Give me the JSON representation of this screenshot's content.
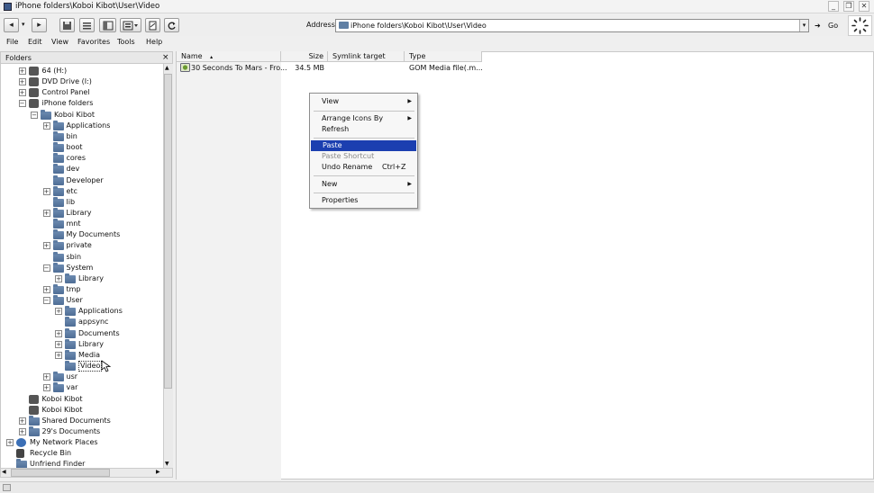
{
  "window": {
    "title": "iPhone folders\\Koboi Kibot\\User\\Video",
    "controls": [
      "_",
      "❐",
      "✕"
    ]
  },
  "toolbar": {
    "back": "◂",
    "back_drop": "▾",
    "forward": "▸",
    "address_label": "Address",
    "address_value": "iPhone folders\\Koboi Kibot\\User\\Video",
    "go_label": "Go"
  },
  "menubar": [
    "File",
    "Edit",
    "View",
    "Favorites",
    "Tools",
    "Help"
  ],
  "folders_pane": {
    "title": "Folders",
    "close": "×",
    "tree": [
      {
        "label": "64 (H:)",
        "level": 1,
        "expander": "+",
        "icon": "drive-icon"
      },
      {
        "label": "DVD Drive (I:)",
        "level": 1,
        "expander": "+",
        "icon": "dvd-drive-icon"
      },
      {
        "label": "Control Panel",
        "level": 1,
        "expander": "+",
        "icon": "control-panel-icon"
      },
      {
        "label": "iPhone folders",
        "level": 1,
        "expander": "−",
        "icon": "iphone-icon"
      },
      {
        "label": "Koboi Kibot",
        "level": 2,
        "expander": "−",
        "icon": "folder-icon"
      },
      {
        "label": "Applications",
        "level": 3,
        "expander": "+",
        "icon": "folder-icon"
      },
      {
        "label": "bin",
        "level": 3,
        "expander": "",
        "icon": "folder-icon"
      },
      {
        "label": "boot",
        "level": 3,
        "expander": "",
        "icon": "folder-icon"
      },
      {
        "label": "cores",
        "level": 3,
        "expander": "",
        "icon": "folder-icon"
      },
      {
        "label": "dev",
        "level": 3,
        "expander": "",
        "icon": "folder-icon"
      },
      {
        "label": "Developer",
        "level": 3,
        "expander": "",
        "icon": "folder-icon"
      },
      {
        "label": "etc",
        "level": 3,
        "expander": "+",
        "icon": "folder-icon"
      },
      {
        "label": "lib",
        "level": 3,
        "expander": "",
        "icon": "folder-icon"
      },
      {
        "label": "Library",
        "level": 3,
        "expander": "+",
        "icon": "folder-icon"
      },
      {
        "label": "mnt",
        "level": 3,
        "expander": "",
        "icon": "folder-icon"
      },
      {
        "label": "My Documents",
        "level": 3,
        "expander": "",
        "icon": "folder-icon"
      },
      {
        "label": "private",
        "level": 3,
        "expander": "+",
        "icon": "folder-icon"
      },
      {
        "label": "sbin",
        "level": 3,
        "expander": "",
        "icon": "folder-icon"
      },
      {
        "label": "System",
        "level": 3,
        "expander": "−",
        "icon": "folder-icon"
      },
      {
        "label": "Library",
        "level": 4,
        "expander": "+",
        "icon": "folder-icon"
      },
      {
        "label": "tmp",
        "level": 3,
        "expander": "+",
        "icon": "folder-icon"
      },
      {
        "label": "User",
        "level": 3,
        "expander": "−",
        "icon": "folder-icon"
      },
      {
        "label": "Applications",
        "level": 4,
        "expander": "+",
        "icon": "folder-icon"
      },
      {
        "label": "appsync",
        "level": 4,
        "expander": "",
        "icon": "folder-icon"
      },
      {
        "label": "Documents",
        "level": 4,
        "expander": "+",
        "icon": "folder-icon"
      },
      {
        "label": "Library",
        "level": 4,
        "expander": "+",
        "icon": "folder-icon"
      },
      {
        "label": "Media",
        "level": 4,
        "expander": "+",
        "icon": "folder-icon"
      },
      {
        "label": "Video",
        "level": 4,
        "expander": "",
        "icon": "folder-icon",
        "selected": true
      },
      {
        "label": "usr",
        "level": 3,
        "expander": "+",
        "icon": "folder-icon"
      },
      {
        "label": "var",
        "level": 3,
        "expander": "+",
        "icon": "folder-icon"
      },
      {
        "label": "Koboi Kibot",
        "level": 1,
        "expander": "",
        "icon": "device-icon"
      },
      {
        "label": "Koboi Kibot",
        "level": 1,
        "expander": "",
        "icon": "device-icon"
      },
      {
        "label": "Shared Documents",
        "level": 1,
        "expander": "+",
        "icon": "folder-icon"
      },
      {
        "label": "29's Documents",
        "level": 1,
        "expander": "+",
        "icon": "folder-icon"
      },
      {
        "label": "My Network Places",
        "level": 0,
        "expander": "+",
        "icon": "network-icon"
      },
      {
        "label": "Recycle Bin",
        "level": 0,
        "expander": "",
        "icon": "recycle-bin-icon"
      },
      {
        "label": "Unfriend Finder",
        "level": 0,
        "expander": "",
        "icon": "folder-icon"
      }
    ]
  },
  "file_list": {
    "columns": [
      "Name",
      "Size",
      "Symlink target",
      "Type"
    ],
    "sort_indicator": "▴",
    "rows": [
      {
        "name": "30 Seconds To Mars - Fro...",
        "size": "34.5 MB",
        "symlink": "",
        "type": "GOM Media file(.m..."
      }
    ]
  },
  "context_menu": {
    "items": [
      {
        "label": "View",
        "submenu": true
      },
      {
        "label": "Arrange Icons By",
        "submenu": true
      },
      {
        "label": "Refresh"
      },
      {
        "label": "Paste",
        "selected": true
      },
      {
        "label": "Paste Shortcut",
        "disabled": true
      },
      {
        "label": "Undo Rename",
        "shortcut": "Ctrl+Z"
      },
      {
        "label": "New",
        "submenu": true
      },
      {
        "label": "Properties"
      }
    ]
  },
  "colors": {
    "selection": "#1b3fb0",
    "folder": "#5f7fa4"
  }
}
